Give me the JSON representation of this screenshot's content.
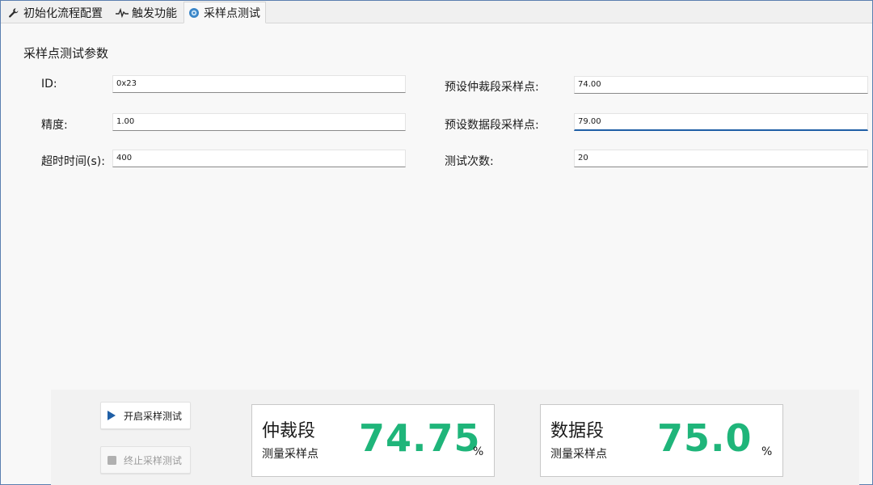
{
  "tabs": [
    {
      "label": "初始化流程配置",
      "icon": "wrench-icon"
    },
    {
      "label": "触发功能",
      "icon": "pulse-icon"
    },
    {
      "label": "采样点测试",
      "icon": "disc-icon"
    }
  ],
  "section_title": "采样点测试参数",
  "form": {
    "id": {
      "label": "ID:",
      "value": "0x23"
    },
    "precision": {
      "label": "精度:",
      "value": "1.00"
    },
    "timeout": {
      "label": "超时时间(s):",
      "value": "400"
    },
    "arb_preset": {
      "label": "预设仲裁段采样点:",
      "value": "74.00"
    },
    "data_preset": {
      "label": "预设数据段采样点:",
      "value": "79.00"
    },
    "test_count": {
      "label": "测试次数:",
      "value": "20"
    }
  },
  "buttons": {
    "start": "开启采样测试",
    "stop": "终止采样测试"
  },
  "cards": {
    "arbitration": {
      "title": "仲裁段",
      "subtitle": "测量采样点",
      "value": "74.75",
      "unit": "%"
    },
    "data": {
      "title": "数据段",
      "subtitle": "测量采样点",
      "value": "75.0",
      "unit": "%"
    }
  },
  "colors": {
    "accent": "#1f5fa6",
    "value_green": "#1fb57a"
  }
}
